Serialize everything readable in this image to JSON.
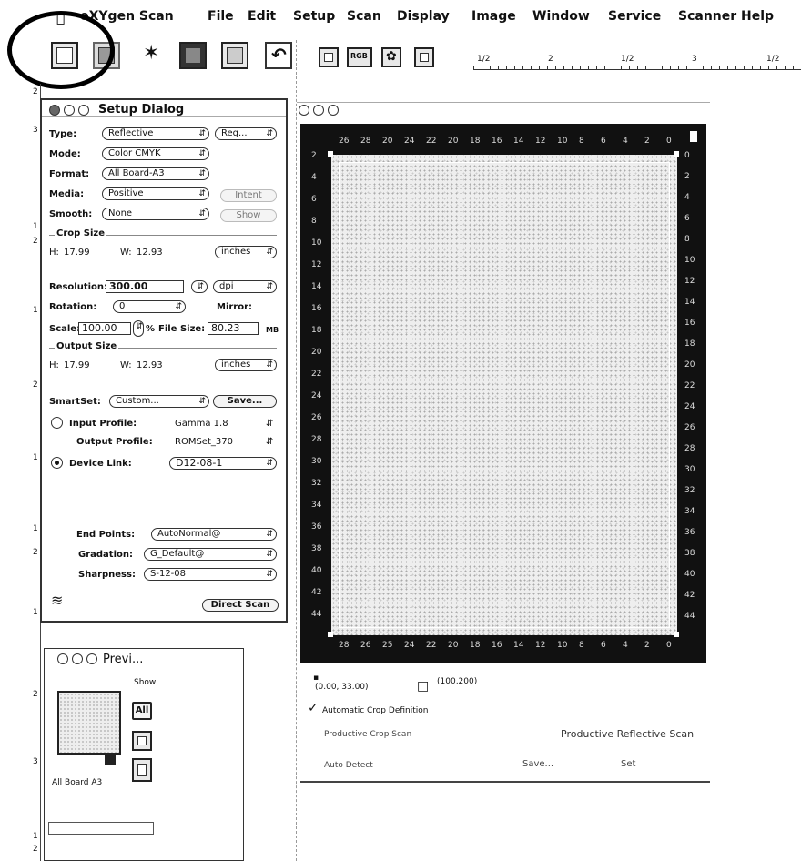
{
  "menubar": {
    "app": "oXYgen Scan",
    "items": [
      "File",
      "Edit",
      "Setup",
      "Scan",
      "Display",
      "Image",
      "Window",
      "Service",
      "Scanner Help"
    ]
  },
  "top_ruler": {
    "labels": [
      "1/2",
      "2",
      "1/2",
      "3",
      "1/2"
    ]
  },
  "left_ruler": {
    "labels": [
      "2",
      "3",
      "1",
      "2",
      "1",
      "2",
      "1",
      "1",
      "2",
      "1",
      "2",
      "3",
      "1",
      "2"
    ]
  },
  "setup_dialog": {
    "title": "Setup Dialog",
    "type_label": "Type:",
    "type_value": "Reflective",
    "type_extra": "Reg...",
    "mode_label": "Mode:",
    "mode_value": "Color CMYK",
    "format_label": "Format:",
    "format_value": "All Board-A3",
    "media_label": "Media:",
    "media_value": "Positive",
    "intent_label": "Intent",
    "smooth_label": "Smooth:",
    "smooth_value": "None",
    "show_label": "Show",
    "crop_size_label": "Crop Size",
    "crop_h_label": "H:",
    "crop_h_value": "17.99",
    "crop_w_label": "W:",
    "crop_w_value": "12.93",
    "crop_units": "inches",
    "resolution_label": "Resolution:",
    "resolution_value": "300.00",
    "resolution_unit": "dpi",
    "rotation_label": "Rotation:",
    "rotation_value": "0",
    "mirror_label": "Mirror:",
    "scale_label": "Scale:",
    "scale_value": "100.00",
    "percent": "%",
    "filesize_label": "File Size:",
    "filesize_value": "80.23",
    "filesize_unit": "MB",
    "output_size_label": "Output Size",
    "out_h_label": "H:",
    "out_h_value": "17.99",
    "out_w_label": "W:",
    "out_w_value": "12.93",
    "out_units": "inches",
    "smartset_label": "SmartSet:",
    "smartset_value": "Custom...",
    "save_label": "Save...",
    "input_profile_label": "Input Profile:",
    "input_profile_value": "Gamma 1.8",
    "output_profile_label": "Output Profile:",
    "output_profile_value": "ROMSet_370",
    "device_link_label": "Device Link:",
    "device_link_value": "D12-08-1",
    "end_points_label": "End Points:",
    "end_points_value": "AutoNormal@",
    "gradation_label": "Gradation:",
    "gradation_value": "G_Default@",
    "sharpness_label": "Sharpness:",
    "sharpness_value": "S-12-08",
    "direct_scan_label": "Direct Scan"
  },
  "preview": {
    "title": "Previ...",
    "show_label": "Show",
    "all_label": "All",
    "format_label": "All Board A3"
  },
  "scan": {
    "top_numbers": [
      "26",
      "28",
      "20",
      "24",
      "22",
      "20",
      "18",
      "16",
      "14",
      "12",
      "10",
      "8",
      "6",
      "4",
      "2",
      "0"
    ],
    "left_numbers": [
      "2",
      "4",
      "6",
      "8",
      "10",
      "12",
      "14",
      "16",
      "18",
      "20",
      "22",
      "24",
      "26",
      "28",
      "30",
      "32",
      "34",
      "36",
      "38",
      "40",
      "42",
      "44"
    ],
    "right_numbers": [
      "0",
      "2",
      "4",
      "6",
      "8",
      "10",
      "12",
      "14",
      "16",
      "18",
      "20",
      "22",
      "24",
      "26",
      "28",
      "30",
      "32",
      "34",
      "36",
      "38",
      "40",
      "42",
      "44"
    ],
    "bottom_numbers": [
      "28",
      "26",
      "25",
      "24",
      "22",
      "20",
      "18",
      "16",
      "14",
      "12",
      "10",
      "8",
      "6",
      "4",
      "2",
      "0"
    ],
    "coords": "(0.00, 33.00)",
    "size": "(100,200)",
    "auto_crop_label": "Automatic Crop Definition",
    "productive_crop_label": "Productive Crop Scan",
    "productive_reflective_label": "Productive Reflective Scan",
    "auto_detect_label": "Auto Detect",
    "save_label": "Save...",
    "set_label": "Set"
  }
}
